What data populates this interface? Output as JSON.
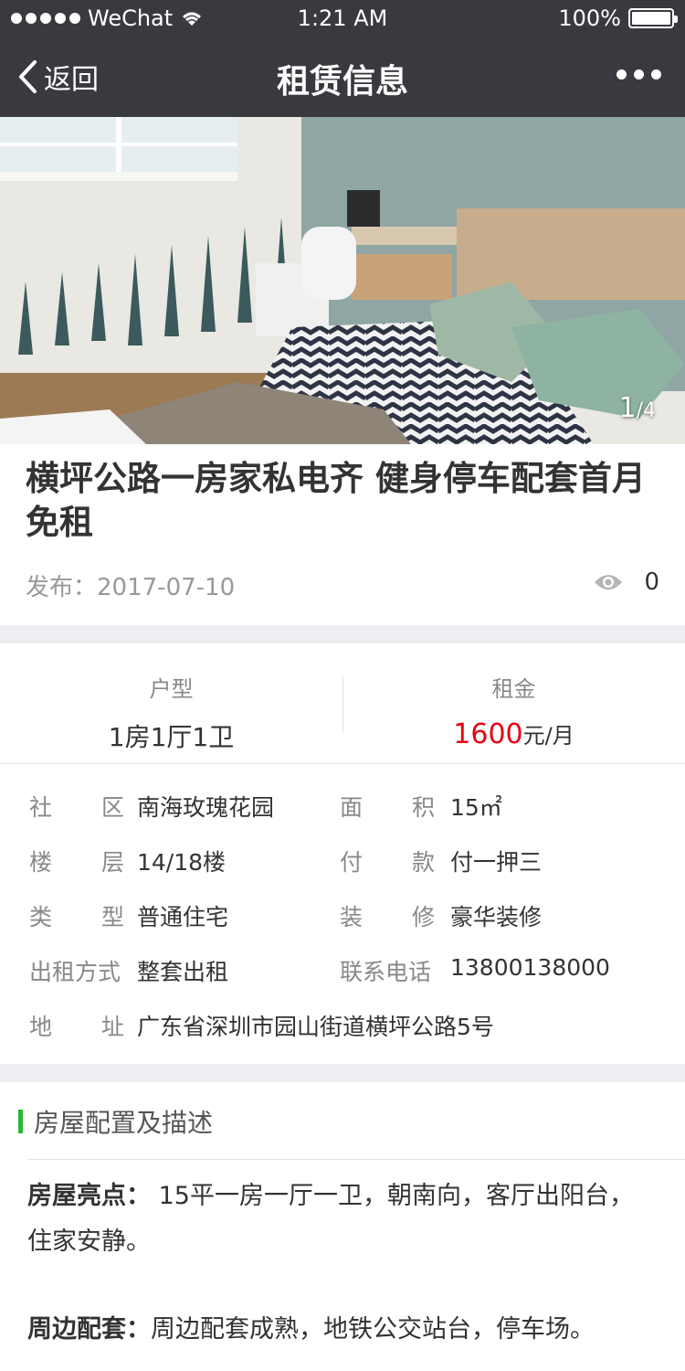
{
  "status": {
    "carrier": "WeChat",
    "time": "1:21 AM",
    "battery": "100%"
  },
  "nav": {
    "back_label": "返回",
    "title": "租赁信息"
  },
  "gallery": {
    "current": "1",
    "total": "/4"
  },
  "listing": {
    "title": "横坪公路一房家私电齐 健身停车配套首月免租",
    "published_label": "发布：",
    "published_date": "2017-07-10",
    "views": "0"
  },
  "summary": {
    "layout_label": "户型",
    "layout_value": "1房1厅1卫",
    "rent_label": "租金",
    "rent_value": "1600",
    "rent_unit": "元/月"
  },
  "details": [
    {
      "label_a": "社",
      "label_b": "区",
      "value": "南海玫瑰花园"
    },
    {
      "label_a": "面",
      "label_b": "积",
      "value": "15㎡"
    },
    {
      "label_a": "楼",
      "label_b": "层",
      "value": "14/18楼"
    },
    {
      "label_a": "付",
      "label_b": "款",
      "value": "付一押三"
    },
    {
      "label_a": "类",
      "label_b": "型",
      "value": "普通住宅"
    },
    {
      "label_a": "装",
      "label_b": "修",
      "value": "豪华装修"
    },
    {
      "label_a": "出租方式",
      "label_b": "",
      "value": "整套出租"
    },
    {
      "label_a": "联系电话",
      "label_b": "",
      "value": "13800138000"
    },
    {
      "label_a": "地",
      "label_b": "址",
      "value": "广东省深圳市园山街道横坪公路5号"
    }
  ],
  "description": {
    "section_title": "房屋配置及描述",
    "highlight_label": "房屋亮点：",
    "highlight_text": " 15平一房一厅一卫，朝南向，客厅出阳台，住家安静。",
    "nearby_label": "周边配套：",
    "nearby_text": "周边配套成熟，地铁公交站台，停车场。"
  },
  "colors": {
    "nav_bg": "#393a3f",
    "rent_red": "#e60012",
    "accent_green": "#25b833",
    "gap_gray": "#eeeef2"
  }
}
